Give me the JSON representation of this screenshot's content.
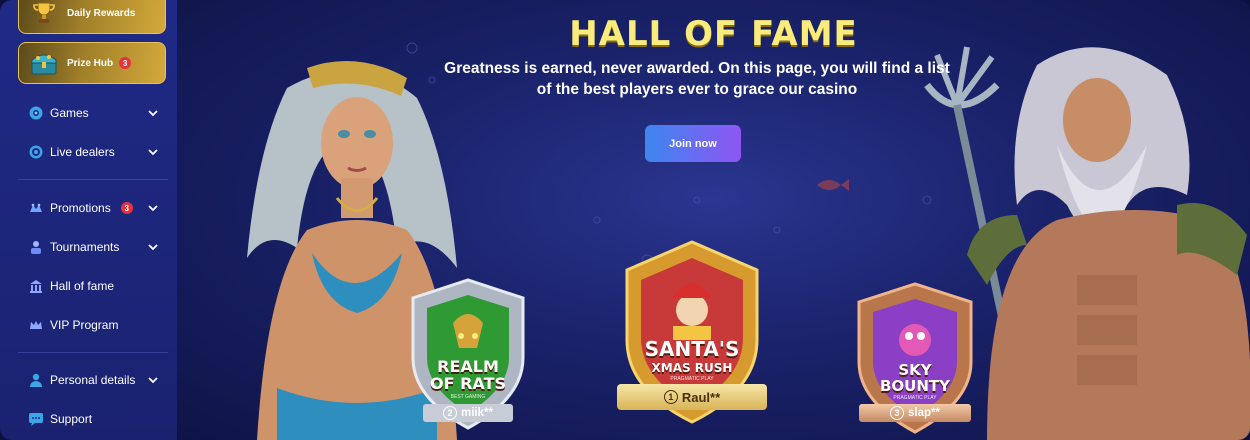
{
  "sidebar": {
    "promos": [
      {
        "label": "Daily Rewards",
        "icon": "trophy-icon"
      },
      {
        "label": "Prize Hub",
        "icon": "treasure-chest-icon",
        "badge": "3"
      }
    ],
    "nav": [
      {
        "label": "Games",
        "icon": "games-icon",
        "expandable": true
      },
      {
        "label": "Live dealers",
        "icon": "live-dealers-icon",
        "expandable": true
      },
      {
        "label": "Promotions",
        "icon": "promotions-icon",
        "expandable": true,
        "badge": "3"
      },
      {
        "label": "Tournaments",
        "icon": "tournaments-icon",
        "expandable": true
      },
      {
        "label": "Hall of fame",
        "icon": "hall-of-fame-icon",
        "expandable": false
      },
      {
        "label": "VIP Program",
        "icon": "crown-icon",
        "expandable": false
      },
      {
        "label": "Personal details",
        "icon": "user-icon",
        "expandable": true
      },
      {
        "label": "Support",
        "icon": "support-icon",
        "expandable": false
      }
    ]
  },
  "hero": {
    "title": "HALL OF FAME",
    "subtitle": "Greatness is earned, never awarded. On this page, you will find a list of the best players ever to grace our casino",
    "join_label": "Join now"
  },
  "podium": [
    {
      "rank": "2",
      "player": "miik**",
      "game_line1": "REALM",
      "game_line2": "OF RATS",
      "provider": "BEST GAMING",
      "tier": "silver"
    },
    {
      "rank": "1",
      "player": "Raul**",
      "game_line1": "SANTA'S",
      "game_line2": "XMAS RUSH",
      "provider": "PRAGMATIC PLAY",
      "tier": "gold"
    },
    {
      "rank": "3",
      "player": "slap**",
      "game_line1": "SKY",
      "game_line2": "BOUNTY",
      "provider": "PRAGMATIC PLAY",
      "tier": "bronze"
    }
  ],
  "colors": {
    "accent_gold": "#f9ec7c",
    "button_start": "#3d86f0",
    "button_end": "#8f55f2",
    "badge_red": "#e5323c",
    "sidebar_bg": "#1f2a86"
  }
}
